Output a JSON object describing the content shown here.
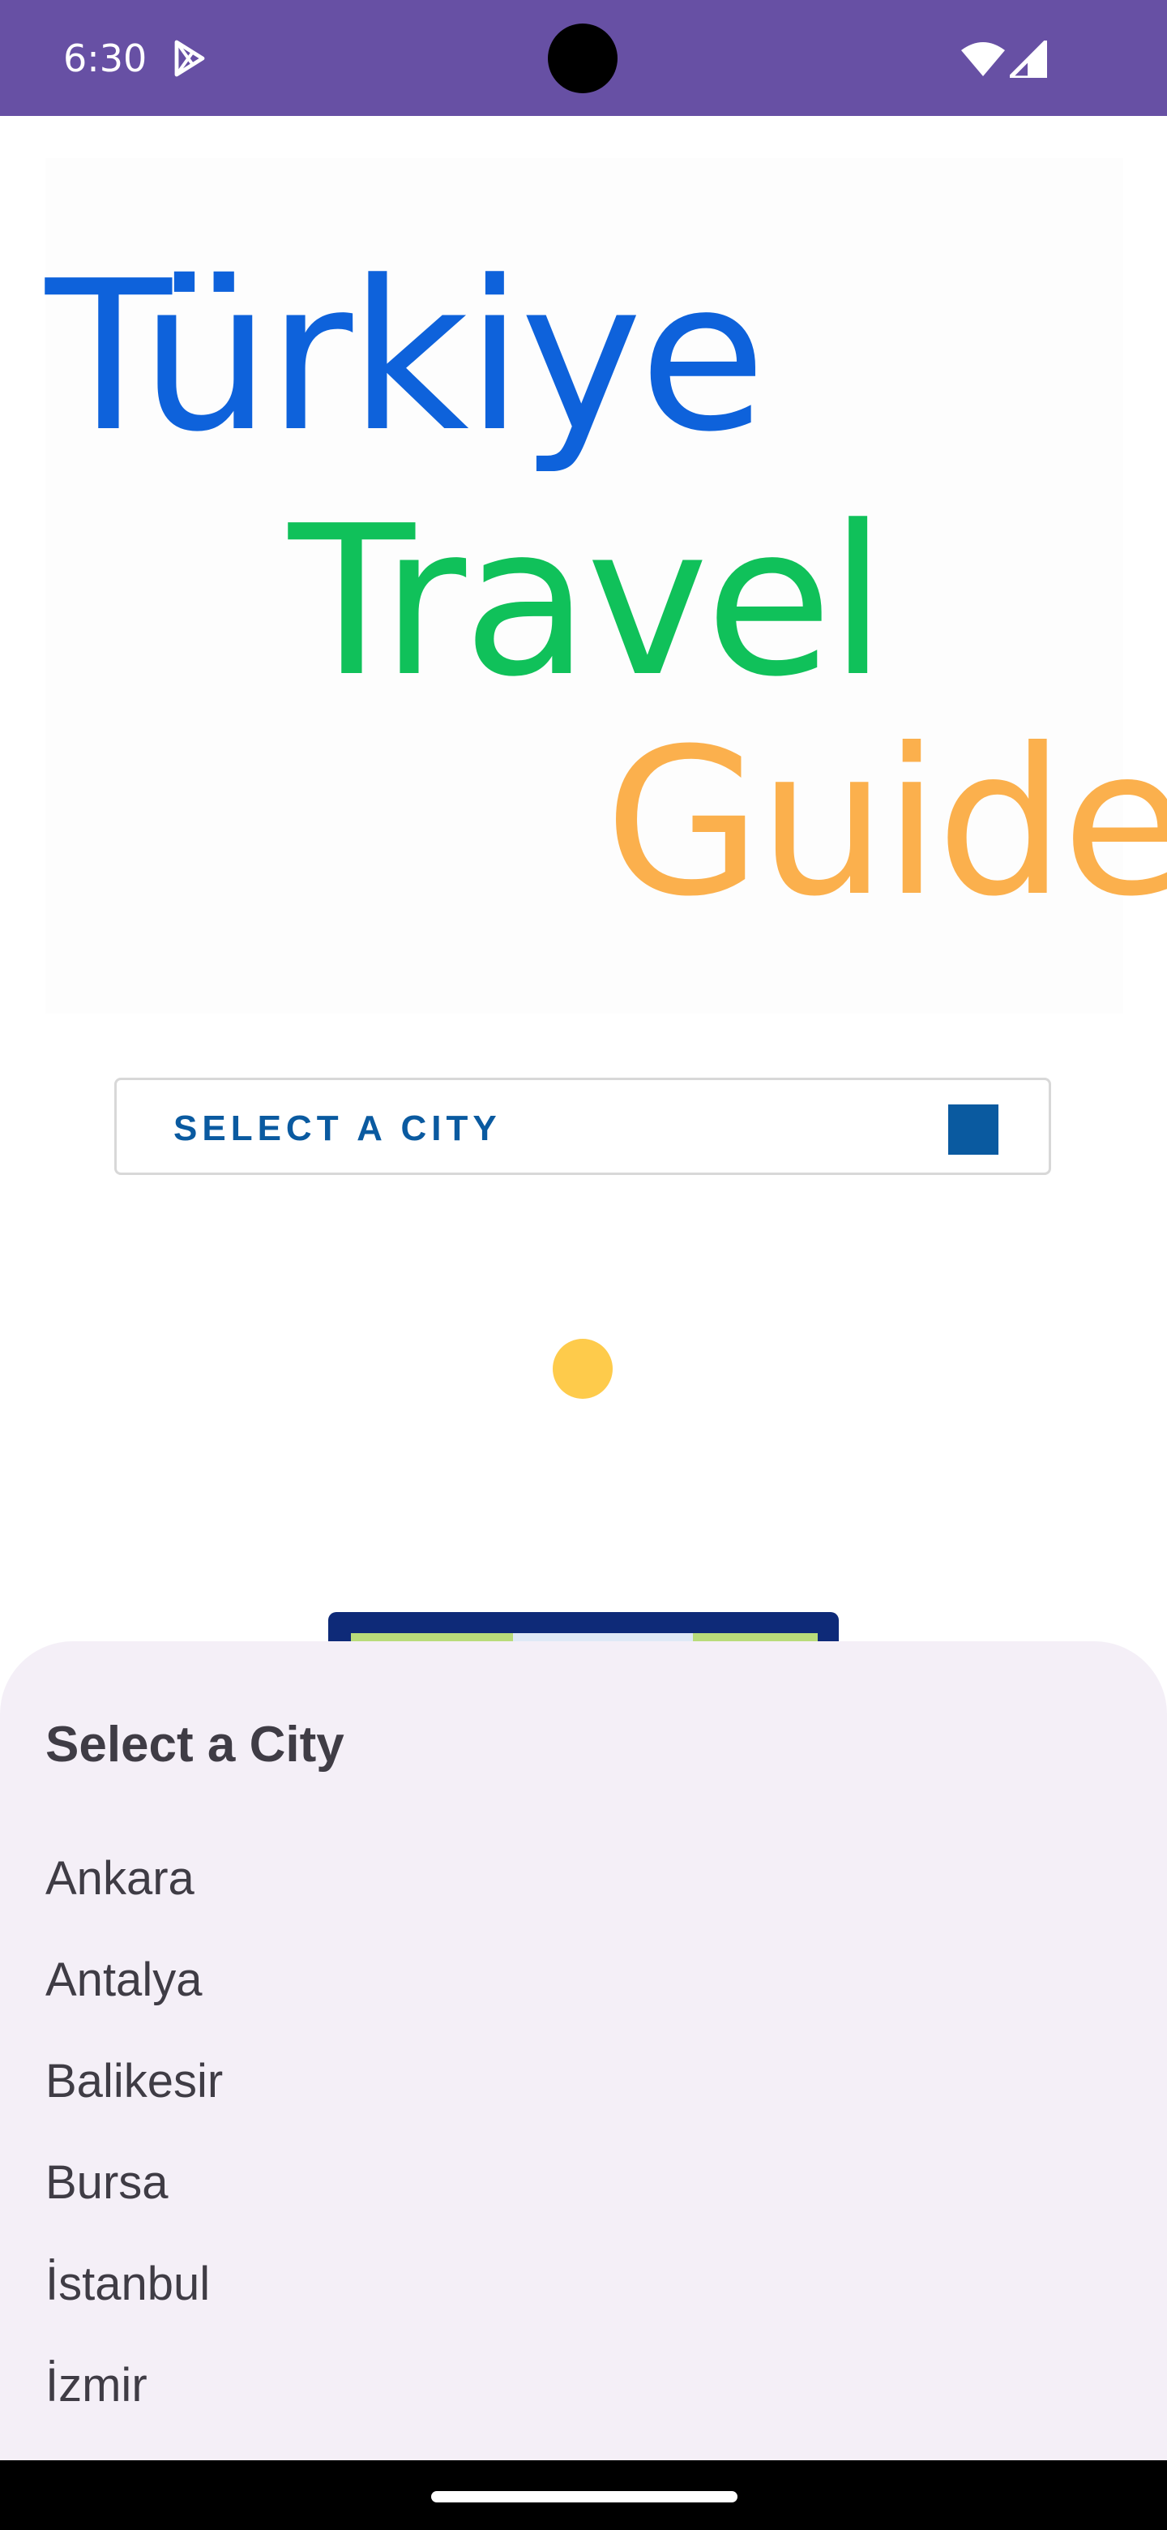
{
  "status_bar": {
    "time": "6:30",
    "icons": [
      "play-store-icon",
      "wifi-icon",
      "cell-signal-icon"
    ],
    "color": "#6750a4"
  },
  "logo": {
    "line1": "Türkiye",
    "line2": "Travel",
    "line3": "Guide",
    "colors": [
      "#0e62db",
      "#10c15a",
      "#fbb04d"
    ]
  },
  "select_button": {
    "label": "SELECT A CITY",
    "accent": "#0a5aa0"
  },
  "loading_dot_color": "#fecb4b",
  "sheet": {
    "title": "Select a City",
    "cities": [
      "Ankara",
      "Antalya",
      "Balikesir",
      "Bursa",
      "İstanbul",
      "İzmir"
    ]
  }
}
